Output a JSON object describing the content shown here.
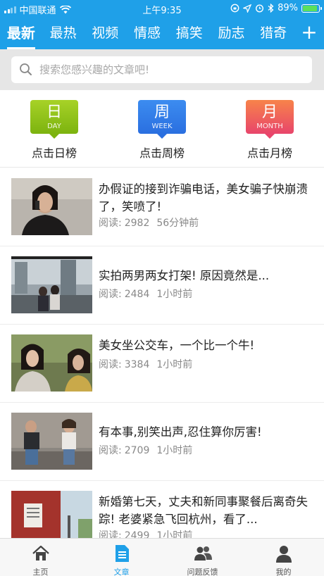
{
  "status": {
    "carrier": "中国联通",
    "time": "上午9:35",
    "battery_percent": "89%",
    "battery_level": 0.89
  },
  "tabs": [
    {
      "label": "最新",
      "active": true
    },
    {
      "label": "最热"
    },
    {
      "label": "视频"
    },
    {
      "label": "情感"
    },
    {
      "label": "搞笑"
    },
    {
      "label": "励志"
    },
    {
      "label": "猎奇"
    }
  ],
  "add_tab_label": "+",
  "search": {
    "placeholder": "搜索您感兴趣的文章吧!"
  },
  "ranks": [
    {
      "char": "日",
      "en": "DAY",
      "label": "点击日榜"
    },
    {
      "char": "周",
      "en": "WEEK",
      "label": "点击周榜"
    },
    {
      "char": "月",
      "en": "MONTH",
      "label": "点击月榜"
    }
  ],
  "articles": [
    {
      "title": "办假证的接到诈骗电话，美女骗子快崩溃了，笑喷了!",
      "read_label": "阅读:",
      "reads": "2982",
      "time": "56分钟前"
    },
    {
      "title": "实拍两男两女打架! 原因竟然是...",
      "read_label": "阅读:",
      "reads": "2484",
      "time": "1小时前"
    },
    {
      "title": "美女坐公交车，一个比一个牛!",
      "read_label": "阅读:",
      "reads": "3384",
      "time": "1小时前"
    },
    {
      "title": "有本事,别笑出声,忍住算你厉害!",
      "read_label": "阅读:",
      "reads": "2709",
      "time": "1小时前"
    },
    {
      "title": "新婚第七天，丈夫和新同事聚餐后离奇失踪! 老婆紧急飞回杭州，看了...",
      "read_label": "阅读:",
      "reads": "2499",
      "time": "1小时前"
    }
  ],
  "nav": [
    {
      "label": "主页",
      "icon": "home-icon"
    },
    {
      "label": "文章",
      "icon": "article-icon",
      "active": true
    },
    {
      "label": "问题反馈",
      "icon": "feedback-icon"
    },
    {
      "label": "我的",
      "icon": "profile-icon"
    }
  ],
  "colors": {
    "accent": "#1fa0e8",
    "day": "#8cc21a",
    "week": "#2f7ee8",
    "month": "#ee5a5e"
  }
}
